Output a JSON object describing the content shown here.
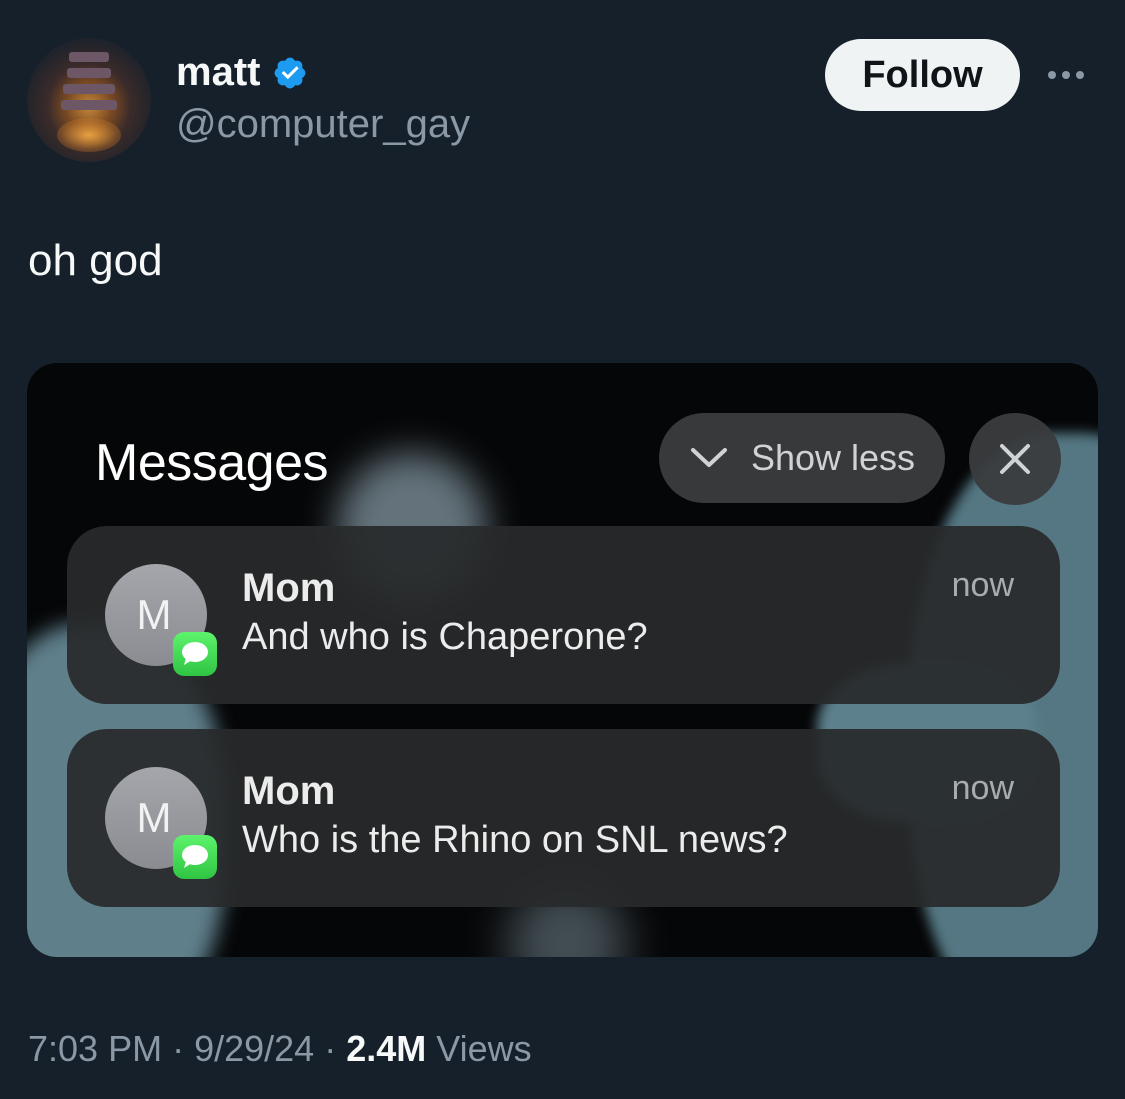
{
  "author": {
    "name": "matt",
    "handle": "@computer_gay",
    "verified_color": "#1d9bf0"
  },
  "follow_label": "Follow",
  "more_icon": "more-horizontal-icon",
  "tweet": {
    "text": "oh god"
  },
  "media": {
    "group_title": "Messages",
    "show_less_label": "Show less",
    "close_icon": "close-icon",
    "notifications": [
      {
        "avatar_letter": "M",
        "sender": "Mom",
        "text": "And who is Chaperone?",
        "time": "now",
        "app_icon": "messages-app-icon"
      },
      {
        "avatar_letter": "M",
        "sender": "Mom",
        "text": "Who is the Rhino on SNL news?",
        "time": "now",
        "app_icon": "messages-app-icon"
      }
    ]
  },
  "meta": {
    "time": "7:03 PM",
    "date": "9/29/24",
    "separator": "·",
    "views_count": "2.4M",
    "views_label": "Views"
  }
}
